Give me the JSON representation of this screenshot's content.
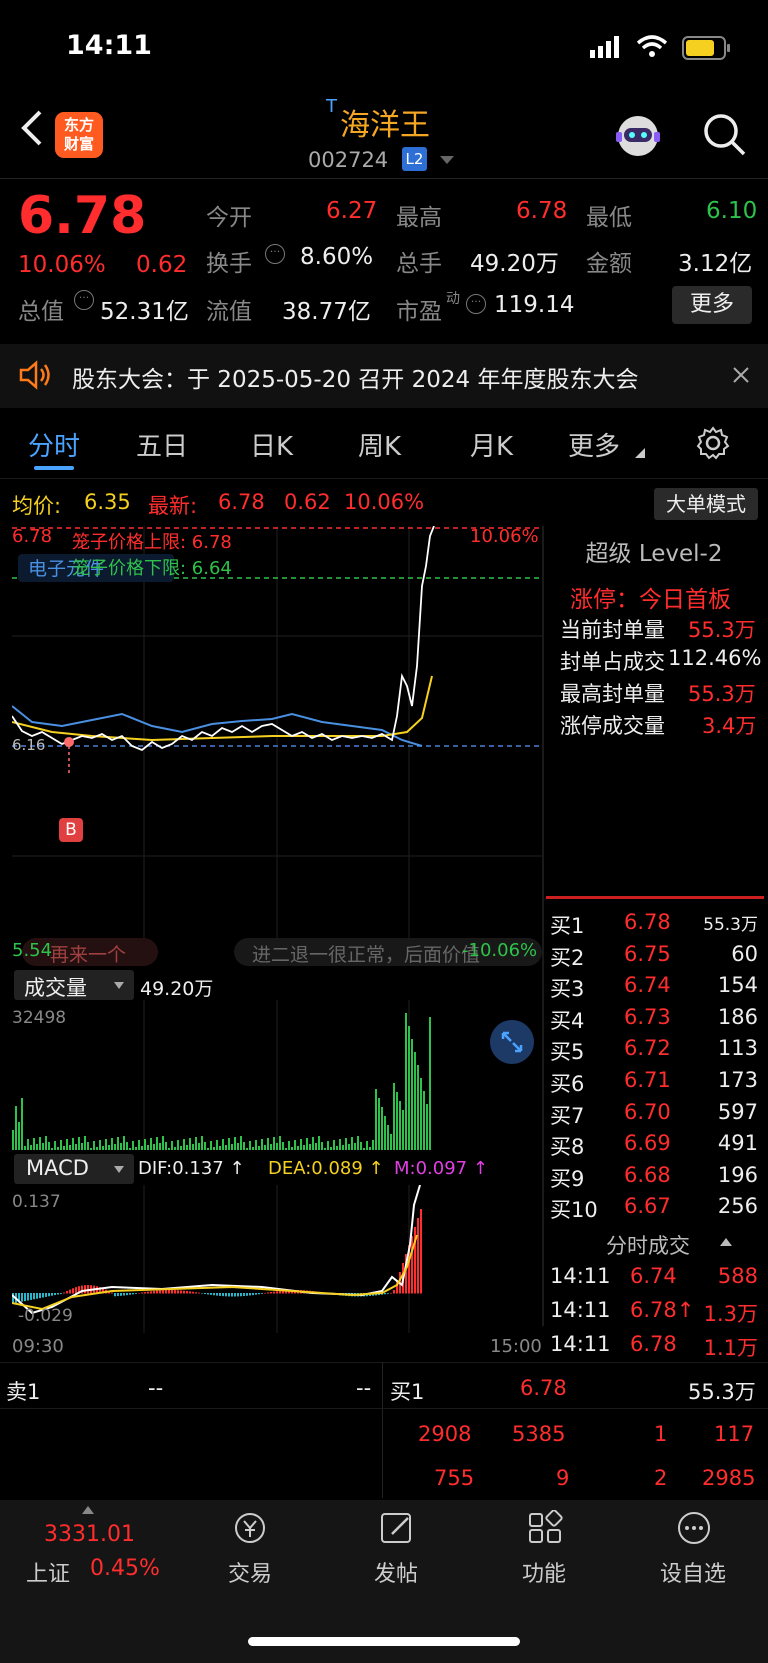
{
  "status_bar": {
    "time": "14:11"
  },
  "header": {
    "title_prefix": "T",
    "title": "海洋王",
    "code": "002724",
    "badge": "L2",
    "logo_line1": "东方",
    "logo_line2": "财富"
  },
  "quote": {
    "price": "6.78",
    "change_pct": "10.06%",
    "change": "0.62",
    "open_label": "今开",
    "open": "6.27",
    "high_label": "最高",
    "high": "6.78",
    "low_label": "最低",
    "low": "6.10",
    "turnover_label": "换手",
    "turnover": "8.60%",
    "volume_label": "总手",
    "volume": "49.20万",
    "amount_label": "金额",
    "amount": "3.12亿",
    "mktcap_label": "总值",
    "mktcap": "52.31亿",
    "float_label": "流值",
    "float": "38.77亿",
    "pe_label": "市盈",
    "pe_sup": "动",
    "pe": "119.14",
    "more": "更多"
  },
  "notice": {
    "text": "股东大会：于 2025-05-20 召开 2024 年年度股东大会"
  },
  "tabs": [
    "分时",
    "五日",
    "日K",
    "周K",
    "月K",
    "更多"
  ],
  "info": {
    "avg_label": "均价:",
    "avg": "6.35",
    "latest_label": "最新:",
    "latest": "6.78",
    "chg": "0.62",
    "pct": "10.06%",
    "mode_btn": "大单模式"
  },
  "chart": {
    "top_price": "6.78",
    "top_pct": "10.06%",
    "upper_label": "笼子价格上限: 6.78",
    "lower_label": "笼子价格下限: 6.64",
    "tag": "电子元件",
    "base_price": "6.16",
    "bottom_price": "5.54",
    "bottom_pct": "-10.06%",
    "bubble1": "再来一个",
    "bubble2": "进二退一很正常，后面价值",
    "buy_marker": "B"
  },
  "level2": {
    "title": "超级 Level-2",
    "limit_label": "涨停：今日首板",
    "rows": [
      {
        "label": "当前封单量",
        "value": "55.3万"
      },
      {
        "label": "封单占成交",
        "value": "112.46%"
      },
      {
        "label": "最高封单量",
        "value": "55.3万"
      },
      {
        "label": "涨停成交量",
        "value": "3.4万"
      }
    ]
  },
  "bids": [
    {
      "label": "买1",
      "price": "6.78",
      "qty": "55.3万"
    },
    {
      "label": "买2",
      "price": "6.75",
      "qty": "60"
    },
    {
      "label": "买3",
      "price": "6.74",
      "qty": "154"
    },
    {
      "label": "买4",
      "price": "6.73",
      "qty": "186"
    },
    {
      "label": "买5",
      "price": "6.72",
      "qty": "113"
    },
    {
      "label": "买6",
      "price": "6.71",
      "qty": "173"
    },
    {
      "label": "买7",
      "price": "6.70",
      "qty": "597"
    },
    {
      "label": "买8",
      "price": "6.69",
      "qty": "491"
    },
    {
      "label": "买9",
      "price": "6.68",
      "qty": "196"
    },
    {
      "label": "买10",
      "price": "6.67",
      "qty": "256"
    }
  ],
  "ticks_title": "分时成交",
  "ticks": [
    {
      "time": "14:11",
      "price": "6.74",
      "qty": "588"
    },
    {
      "time": "14:11",
      "price": "6.78↑",
      "qty": "1.3万"
    },
    {
      "time": "14:11",
      "price": "6.78",
      "qty": "1.1万"
    }
  ],
  "volume": {
    "label": "成交量",
    "total": "49.20万",
    "max": "32498"
  },
  "macd": {
    "label": "MACD",
    "dif": "DIF:0.137 ↑",
    "dea": "DEA:0.089 ↑",
    "m": "M:0.097 ↑",
    "top": "0.137",
    "bottom": "-0.029",
    "t_start": "09:30",
    "t_end": "15:00"
  },
  "order_summary": {
    "sell_label": "卖1",
    "sell_p": "--",
    "sell_q": "--",
    "buy_label": "买1",
    "buy_p": "6.78",
    "buy_q": "55.3万",
    "row2": [
      "2908",
      "5385",
      "1",
      "117"
    ],
    "row3": [
      "755",
      "9",
      "2",
      "2985"
    ]
  },
  "bottom_nav": {
    "index_value": "3331.01",
    "index_name": "上证",
    "index_pct": "0.45%",
    "items": [
      "交易",
      "发帖",
      "功能",
      "设自选"
    ]
  },
  "colors": {
    "up": "#ff2d2d",
    "down": "#2ec24a",
    "accent": "#4aa3ff",
    "avg": "#f5d020"
  }
}
